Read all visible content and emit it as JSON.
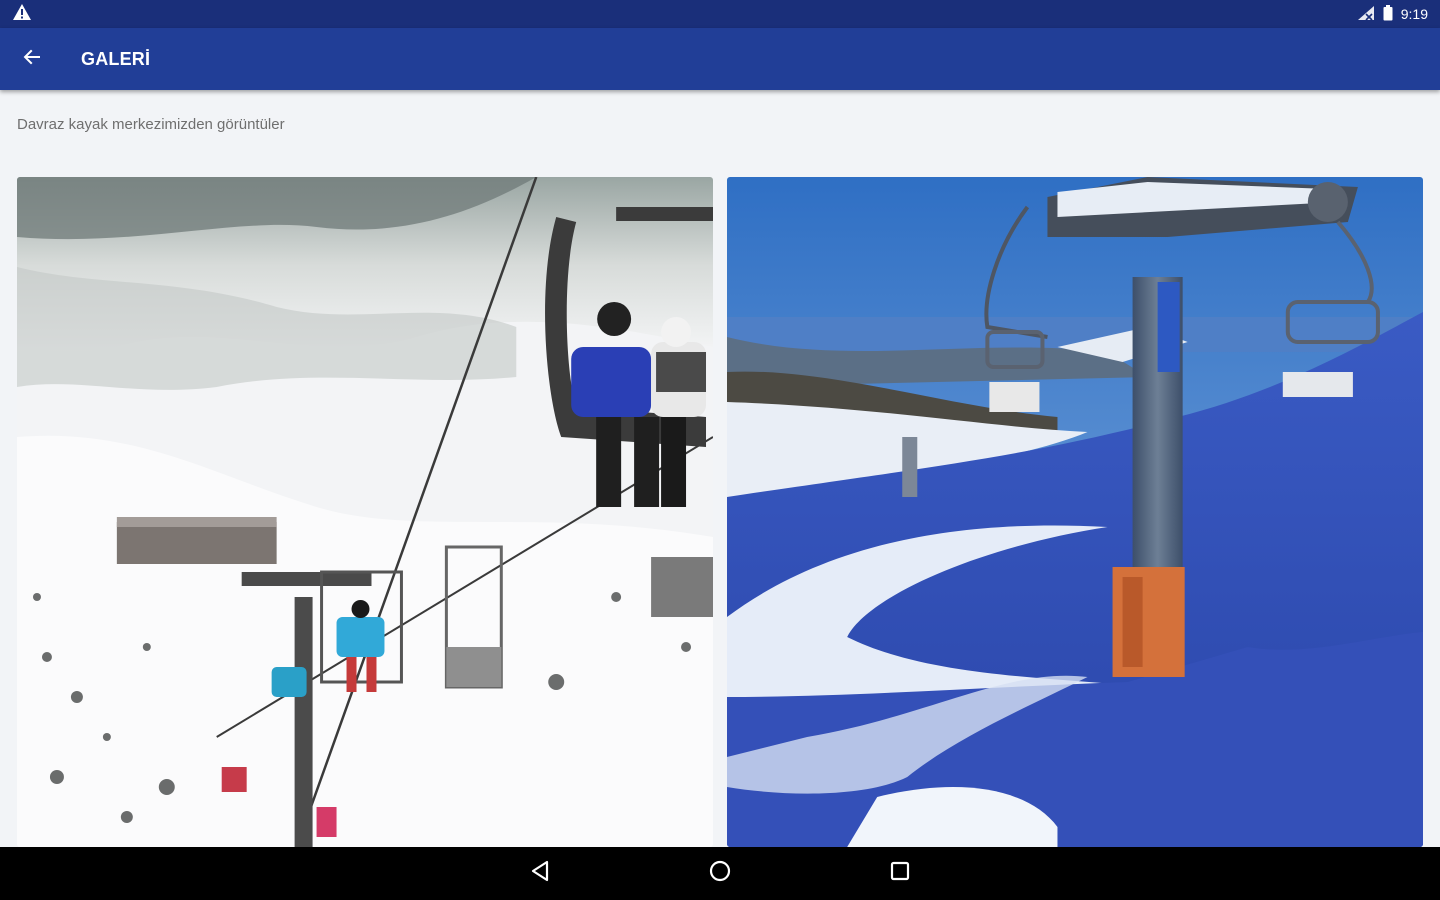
{
  "status_bar": {
    "time": "9:19",
    "icons": [
      "warning-icon",
      "no-signal-icon",
      "battery-icon"
    ]
  },
  "app_bar": {
    "title": "GALERİ",
    "back_icon": "arrow-back-icon",
    "background": "#213e97"
  },
  "page": {
    "subtitle": "Davraz kayak merkezimizden görüntüler"
  },
  "gallery": {
    "photos": [
      {
        "subject": "chairlift-with-skiers-snowy-slope"
      },
      {
        "subject": "chairlift-tower-deep-snow-blue-sky"
      }
    ]
  },
  "nav_bar": {
    "buttons": [
      "nav-back-icon",
      "nav-home-icon",
      "nav-recents-icon"
    ]
  }
}
